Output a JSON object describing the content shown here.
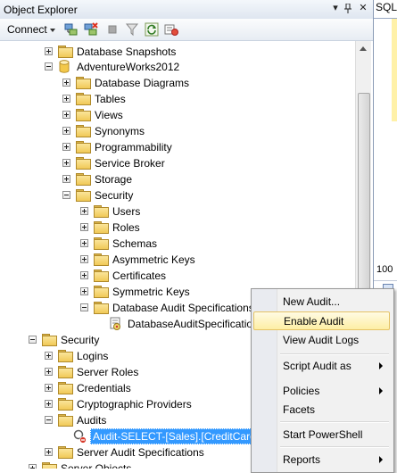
{
  "panel": {
    "title": "Object Explorer",
    "connect_label": "Connect"
  },
  "document": {
    "tab_label": "SQL",
    "zoom": "100"
  },
  "tree": [
    {
      "label": "Database Snapshots",
      "icon": "folder",
      "exp": "plus"
    },
    {
      "label": "AdventureWorks2012",
      "icon": "database",
      "exp": "minus"
    },
    {
      "label": "Database Diagrams",
      "icon": "folder",
      "exp": "plus"
    },
    {
      "label": "Tables",
      "icon": "folder",
      "exp": "plus"
    },
    {
      "label": "Views",
      "icon": "folder",
      "exp": "plus"
    },
    {
      "label": "Synonyms",
      "icon": "folder",
      "exp": "plus"
    },
    {
      "label": "Programmability",
      "icon": "folder",
      "exp": "plus"
    },
    {
      "label": "Service Broker",
      "icon": "folder",
      "exp": "plus"
    },
    {
      "label": "Storage",
      "icon": "folder",
      "exp": "plus"
    },
    {
      "label": "Security",
      "icon": "folder",
      "exp": "minus"
    },
    {
      "label": "Users",
      "icon": "folder",
      "exp": "plus"
    },
    {
      "label": "Roles",
      "icon": "folder",
      "exp": "plus"
    },
    {
      "label": "Schemas",
      "icon": "folder",
      "exp": "plus"
    },
    {
      "label": "Asymmetric Keys",
      "icon": "folder",
      "exp": "plus"
    },
    {
      "label": "Certificates",
      "icon": "folder",
      "exp": "plus"
    },
    {
      "label": "Symmetric Keys",
      "icon": "folder",
      "exp": "plus"
    },
    {
      "label": "Database Audit Specifications",
      "icon": "folder",
      "exp": "minus"
    },
    {
      "label": "DatabaseAuditSpecification",
      "icon": "audit-spec",
      "exp": "none"
    },
    {
      "label": "Security",
      "icon": "folder",
      "exp": "minus"
    },
    {
      "label": "Logins",
      "icon": "folder",
      "exp": "plus"
    },
    {
      "label": "Server Roles",
      "icon": "folder",
      "exp": "plus"
    },
    {
      "label": "Credentials",
      "icon": "folder",
      "exp": "plus"
    },
    {
      "label": "Cryptographic Providers",
      "icon": "folder",
      "exp": "plus"
    },
    {
      "label": "Audits",
      "icon": "folder",
      "exp": "minus"
    },
    {
      "label": "Audit-SELECT-[Sales].[CreditCard",
      "icon": "audit-disabled",
      "exp": "none",
      "selected": true
    },
    {
      "label": "Server Audit Specifications",
      "icon": "folder",
      "exp": "plus"
    },
    {
      "label": "Server Objects",
      "icon": "folder",
      "exp": "plus"
    }
  ],
  "context_menu": [
    {
      "label": "New Audit..."
    },
    {
      "label": "Enable Audit",
      "highlighted": true
    },
    {
      "label": "View Audit Logs"
    },
    {
      "label": "Script Audit as",
      "submenu": true
    },
    {
      "label": "Policies",
      "submenu": true
    },
    {
      "label": "Facets"
    },
    {
      "label": "Start PowerShell"
    },
    {
      "label": "Reports",
      "submenu": true
    }
  ]
}
